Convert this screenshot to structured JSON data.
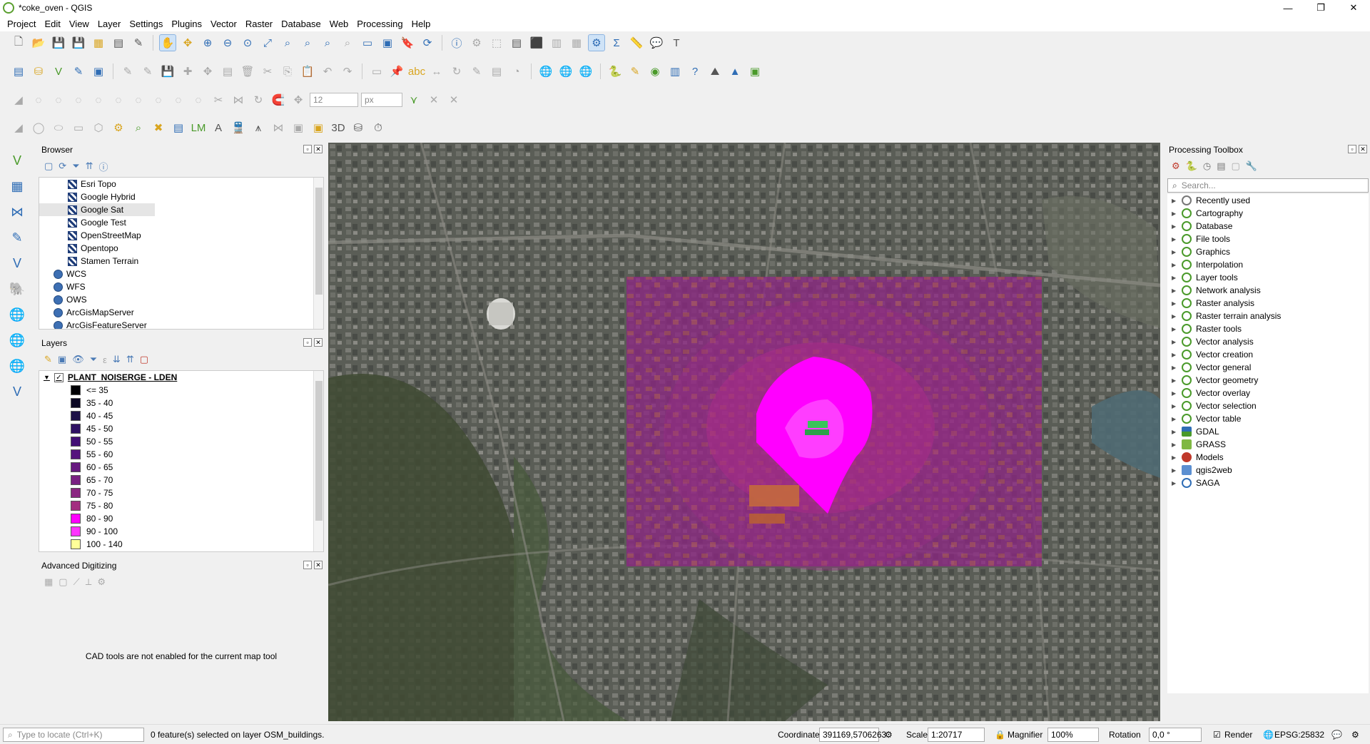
{
  "window": {
    "title": "*coke_oven - QGIS",
    "minimize": "—",
    "maximize": "❐",
    "close": "✕"
  },
  "menu": [
    "Project",
    "Edit",
    "View",
    "Layer",
    "Settings",
    "Plugins",
    "Vector",
    "Raster",
    "Database",
    "Web",
    "Processing",
    "Help"
  ],
  "digitize": {
    "size_value": "12",
    "unit_value": "px"
  },
  "browser": {
    "title": "Browser",
    "items": [
      {
        "label": "Esri Topo",
        "icon": "xyz-tile-icon",
        "indent": 2
      },
      {
        "label": "Google Hybrid",
        "icon": "xyz-tile-icon",
        "indent": 2
      },
      {
        "label": "Google Sat",
        "icon": "xyz-tile-icon",
        "indent": 2,
        "selected": true
      },
      {
        "label": "Google Test",
        "icon": "xyz-tile-icon",
        "indent": 2
      },
      {
        "label": "OpenStreetMap",
        "icon": "xyz-tile-icon",
        "indent": 2
      },
      {
        "label": "Opentopo",
        "icon": "xyz-tile-icon",
        "indent": 2
      },
      {
        "label": "Stamen Terrain",
        "icon": "xyz-tile-icon",
        "indent": 2
      },
      {
        "label": "WCS",
        "icon": "globe-icon",
        "indent": 1
      },
      {
        "label": "WFS",
        "icon": "globe-icon",
        "indent": 1
      },
      {
        "label": "OWS",
        "icon": "globe-icon",
        "indent": 1
      },
      {
        "label": "ArcGisMapServer",
        "icon": "globe-icon",
        "indent": 1
      },
      {
        "label": "ArcGisFeatureServer",
        "icon": "globe-icon",
        "indent": 1
      }
    ]
  },
  "layers": {
    "title": "Layers",
    "layer_name": "PLANT_NOISERGE - LDEN",
    "legend": [
      {
        "label": "<= 35",
        "color": "#000004"
      },
      {
        "label": "35 - 40",
        "color": "#0b0724"
      },
      {
        "label": "40 - 45",
        "color": "#1d1147"
      },
      {
        "label": "45 - 50",
        "color": "#2f1163"
      },
      {
        "label": "50 - 55",
        "color": "#420f75"
      },
      {
        "label": "55 - 60",
        "color": "#55137d"
      },
      {
        "label": "60 - 65",
        "color": "#67197f"
      },
      {
        "label": "65 - 70",
        "color": "#792082"
      },
      {
        "label": "70 - 75",
        "color": "#8b2681"
      },
      {
        "label": "75 - 80",
        "color": "#a32e80"
      },
      {
        "label": "80 - 90",
        "color": "#ff00ff"
      },
      {
        "label": "90 - 100",
        "color": "#ff33ff"
      },
      {
        "label": "100 - 140",
        "color": "#ffff99"
      }
    ]
  },
  "advanced_digitizing": {
    "title": "Advanced Digitizing",
    "message": "CAD tools are not enabled for the current map tool"
  },
  "toolbox": {
    "title": "Processing Toolbox",
    "search_placeholder": "Search...",
    "items": [
      {
        "label": "Recently used",
        "icon": "clock"
      },
      {
        "label": "Cartography",
        "icon": "qgis"
      },
      {
        "label": "Database",
        "icon": "qgis"
      },
      {
        "label": "File tools",
        "icon": "qgis"
      },
      {
        "label": "Graphics",
        "icon": "qgis"
      },
      {
        "label": "Interpolation",
        "icon": "qgis"
      },
      {
        "label": "Layer tools",
        "icon": "qgis"
      },
      {
        "label": "Network analysis",
        "icon": "qgis"
      },
      {
        "label": "Raster analysis",
        "icon": "qgis"
      },
      {
        "label": "Raster terrain analysis",
        "icon": "qgis"
      },
      {
        "label": "Raster tools",
        "icon": "qgis"
      },
      {
        "label": "Vector analysis",
        "icon": "qgis"
      },
      {
        "label": "Vector creation",
        "icon": "qgis"
      },
      {
        "label": "Vector general",
        "icon": "qgis"
      },
      {
        "label": "Vector geometry",
        "icon": "qgis"
      },
      {
        "label": "Vector overlay",
        "icon": "qgis"
      },
      {
        "label": "Vector selection",
        "icon": "qgis"
      },
      {
        "label": "Vector table",
        "icon": "qgis"
      },
      {
        "label": "GDAL",
        "icon": "gdal"
      },
      {
        "label": "GRASS",
        "icon": "grass"
      },
      {
        "label": "Models",
        "icon": "models"
      },
      {
        "label": "qgis2web",
        "icon": "q2w"
      },
      {
        "label": "SAGA",
        "icon": "saga"
      }
    ]
  },
  "statusbar": {
    "locate_placeholder": "Type to locate (Ctrl+K)",
    "message": "0 feature(s) selected on layer OSM_buildings.",
    "coordinate_label": "Coordinate",
    "coordinate_value": "391169,5706263",
    "scale_label": "Scale",
    "scale_value": "1:20717",
    "magnifier_label": "Magnifier",
    "magnifier_value": "100%",
    "rotation_label": "Rotation",
    "rotation_value": "0,0 °",
    "render_label": "Render",
    "crs": "EPSG:25832"
  },
  "colors": {
    "noise_overlay": "#8b2681",
    "noise_hot": "#ff00ff",
    "map_bg": "#4b5247"
  }
}
